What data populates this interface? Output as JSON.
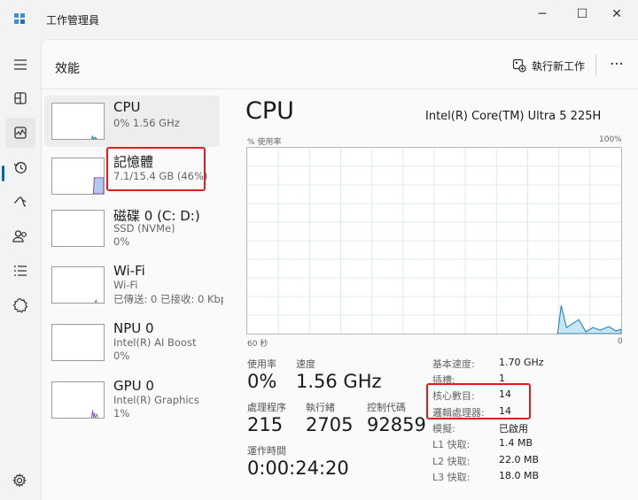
{
  "window": {
    "title": "工作管理員",
    "minimize": "─",
    "maximize": "☐",
    "close": "✕"
  },
  "header": {
    "page_title": "效能",
    "run_task_label": "執行新工作",
    "more_label": "⋯"
  },
  "nav": {
    "items": [
      {
        "name": "hamburger-icon"
      },
      {
        "name": "processes-icon"
      },
      {
        "name": "performance-icon",
        "active": true
      },
      {
        "name": "app-history-icon"
      },
      {
        "name": "startup-apps-icon"
      },
      {
        "name": "users-icon"
      },
      {
        "name": "details-icon"
      },
      {
        "name": "services-icon"
      }
    ],
    "settings": "settings-icon"
  },
  "devices": [
    {
      "name": "CPU",
      "line1": "0% 1.56 GHz",
      "line2": "",
      "selected": true
    },
    {
      "name": "記憶體",
      "line1": "7.1/15.4 GB (46%)",
      "line2": "",
      "highlight": true
    },
    {
      "name": "磁碟 0 (C: D:)",
      "line1": "SSD (NVMe)",
      "line2": "0%"
    },
    {
      "name": "Wi-Fi",
      "line1": "Wi-Fi",
      "line2": "已傳送: 0 已接收: 0 Kbp"
    },
    {
      "name": "NPU 0",
      "line1": "Intel(R) AI Boost",
      "line2": "0%"
    },
    {
      "name": "GPU 0",
      "line1": "Intel(R) Graphics",
      "line2": "1%"
    }
  ],
  "detail": {
    "title": "CPU",
    "model": "Intel(R) Core(TM) Ultra 5 225H",
    "graph": {
      "y_label": "% 使用率",
      "y_max": "100%",
      "x_left": "60 秒",
      "x_right": "0"
    },
    "stats": {
      "utilization": {
        "label": "使用率",
        "value": "0%"
      },
      "speed": {
        "label": "速度",
        "value": "1.56 GHz"
      },
      "processes": {
        "label": "處理程序",
        "value": "215"
      },
      "threads": {
        "label": "執行緒",
        "value": "2705"
      },
      "handles": {
        "label": "控制代碼",
        "value": "92859"
      },
      "uptime": {
        "label": "運作時間",
        "value": "0:00:24:20"
      }
    },
    "specs": [
      {
        "label": "基本速度:",
        "value": "1.70 GHz"
      },
      {
        "label": "插槽:",
        "value": "1"
      },
      {
        "label": "核心數目:",
        "value": "14"
      },
      {
        "label": "邏輯處理器:",
        "value": "14"
      },
      {
        "label": "模擬:",
        "value": "已啟用"
      },
      {
        "label": "L1 快取:",
        "value": "1.4 MB"
      },
      {
        "label": "L2 快取:",
        "value": "22.0 MB"
      },
      {
        "label": "L3 快取:",
        "value": "18.0 MB"
      }
    ]
  },
  "colors": {
    "cpu": "#117dbb",
    "cpu_fill": "#c9e6f5",
    "memory": "#8b12ae",
    "memory_fill": "#b3c8ec",
    "wifi": "#a74f01",
    "gpu": "#7b3fd0",
    "highlight": "#e01e1e"
  }
}
